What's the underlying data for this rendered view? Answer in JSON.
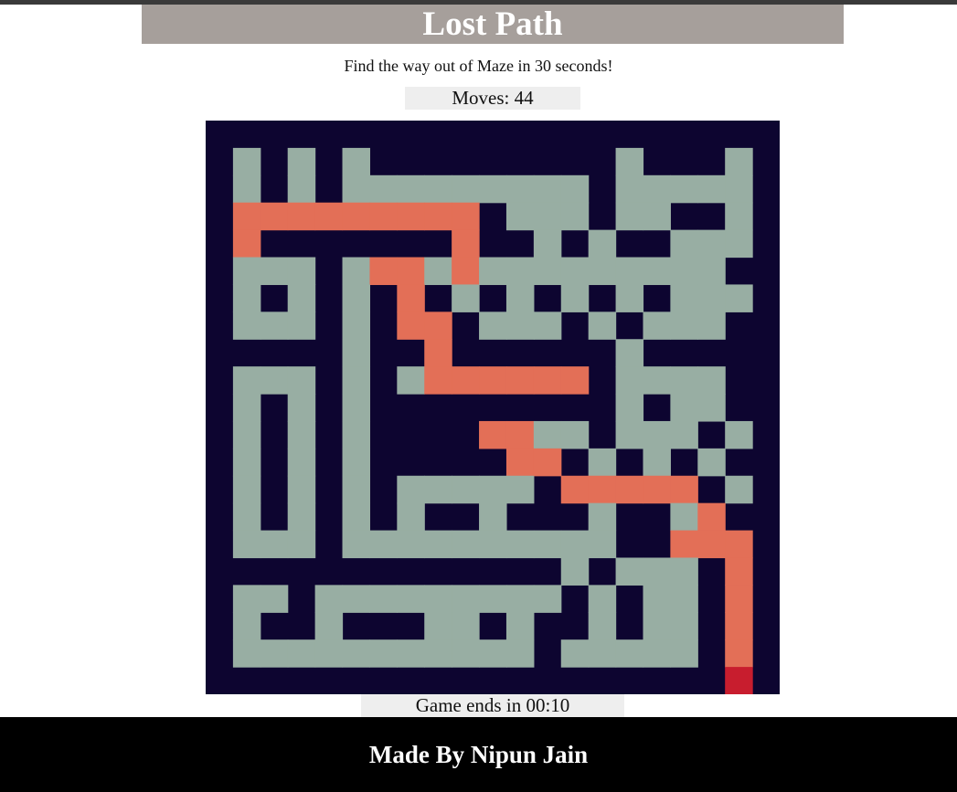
{
  "title": "Lost Path",
  "instructions": "Find the way out of Maze in 30 seconds!",
  "moves": "Moves: 44",
  "timer": "Game ends in 00:10",
  "footer": "Made By Nipun Jain",
  "colors": {
    "wall": "#0d0530",
    "path": "#98aea3",
    "trail": "#e36f57",
    "player": "#c81d2e",
    "title_bg": "#a69f9b",
    "info_bg": "#eeeeee"
  },
  "maze": {
    "legend": {
      "#": "wall",
      ".": "path",
      "o": "trail",
      "P": "player"
    },
    "rows": [
      "#####################",
      "#.#.#.#########.###.#",
      "#.#.#.........#.....#",
      "#ooooooooo#...#..##.#",
      "#o#######o##.#.##...#",
      "#...#.oo.o.........##",
      "#.#.#.#o#.#.#.#.#...#",
      "#...#.#oo#...#.#...##",
      "#####.##o######.#####",
      "#...#.#.oooooo#....#",
      "#.#.#.#########.#..#",
      "#.#.#.####oo..#...#.#",
      "#.#.#.#####oo#.#.#.##",
      "#.#.#.#.....#ooooo#.#",
      "#.#.#.#.##.###.##.o##",
      "#...#..........##ooo#",
      "#############.#...#o#",
      "#..#.........#.#..#o#",
      "#.##.###..#.##.#..#o#",
      "#...........#.....#o#",
      "###################P#"
    ]
  }
}
